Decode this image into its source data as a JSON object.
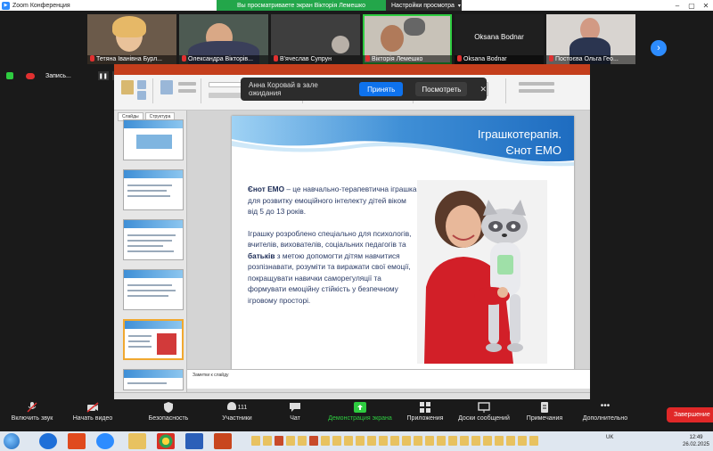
{
  "window": {
    "title": "Zoom Конференция",
    "view_banner": "Вы просматриваете экран Вікторія Лемешко",
    "view_settings": "Настройки просмотра"
  },
  "gallery": {
    "participants": [
      {
        "name": "Тетяна Іванівна Бурл...",
        "muted": true
      },
      {
        "name": "Олександра Вікторів...",
        "muted": true
      },
      {
        "name": "В'ячеслав Супрун",
        "muted": true
      },
      {
        "name": "Вікторія Лемешко",
        "muted": true,
        "speaking": true
      },
      {
        "name": "Oksana Bodnar",
        "muted": true
      },
      {
        "name": "Постоєва Ольга Гео...",
        "muted": true
      }
    ],
    "video_off_label": "Oksana Bodnar"
  },
  "recording": {
    "label": "Запись..."
  },
  "waiting_room": {
    "message": "Анна Коровай в зале ожидания",
    "accept_label": "Принять",
    "view_label": "Посмотреть",
    "close_glyph": "✕"
  },
  "powerpoint": {
    "panel_tabs": [
      "Слайды",
      "Структура"
    ],
    "slide_numbers": [
      "1",
      "2",
      "3",
      "4",
      "5",
      "6"
    ],
    "notes_placeholder": "Заметки к слайду",
    "slide": {
      "title_line1": "Іграшкотерапія.",
      "title_line2": "Єнот ЕМО",
      "p1_bold": "Єнот ЕМО",
      "p1_rest": " – це навчально-терапевтична іграшка для розвитку емоційного інтелекту дітей віком від 5 до 13 років.",
      "p2_a": "Іграшку розроблено спеціально для психологів, вчителів, вихователів, соціальних педагогів та ",
      "p2_bold": "батьків",
      "p2_b": " з метою допомогти дітям навчитися розпізнавати, розуміти та виражати свої емоції, покращувати навички саморегуляції та формувати емоційну стійкість у безпечному ігровому просторі."
    }
  },
  "toolbar": {
    "mute": "Включить звук",
    "video": "Начать видео",
    "security": "Безопасность",
    "participants": "Участники",
    "participants_count": "111",
    "chat": "Чат",
    "share": "Демонстрация экрана",
    "apps": "Приложения",
    "whiteboards": "Доски сообщений",
    "notes": "Примечания",
    "more": "Дополнительно",
    "end": "Завершение"
  },
  "taskbar": {
    "lang": "UK",
    "time": "12:49",
    "date": "26.02.2025"
  },
  "colors": {
    "zoom_blue": "#2d8cff",
    "banner_green": "#23a64a",
    "end_red": "#e02828",
    "slide_text": "#2a3b66",
    "powerpoint_red": "#c43e1c"
  }
}
